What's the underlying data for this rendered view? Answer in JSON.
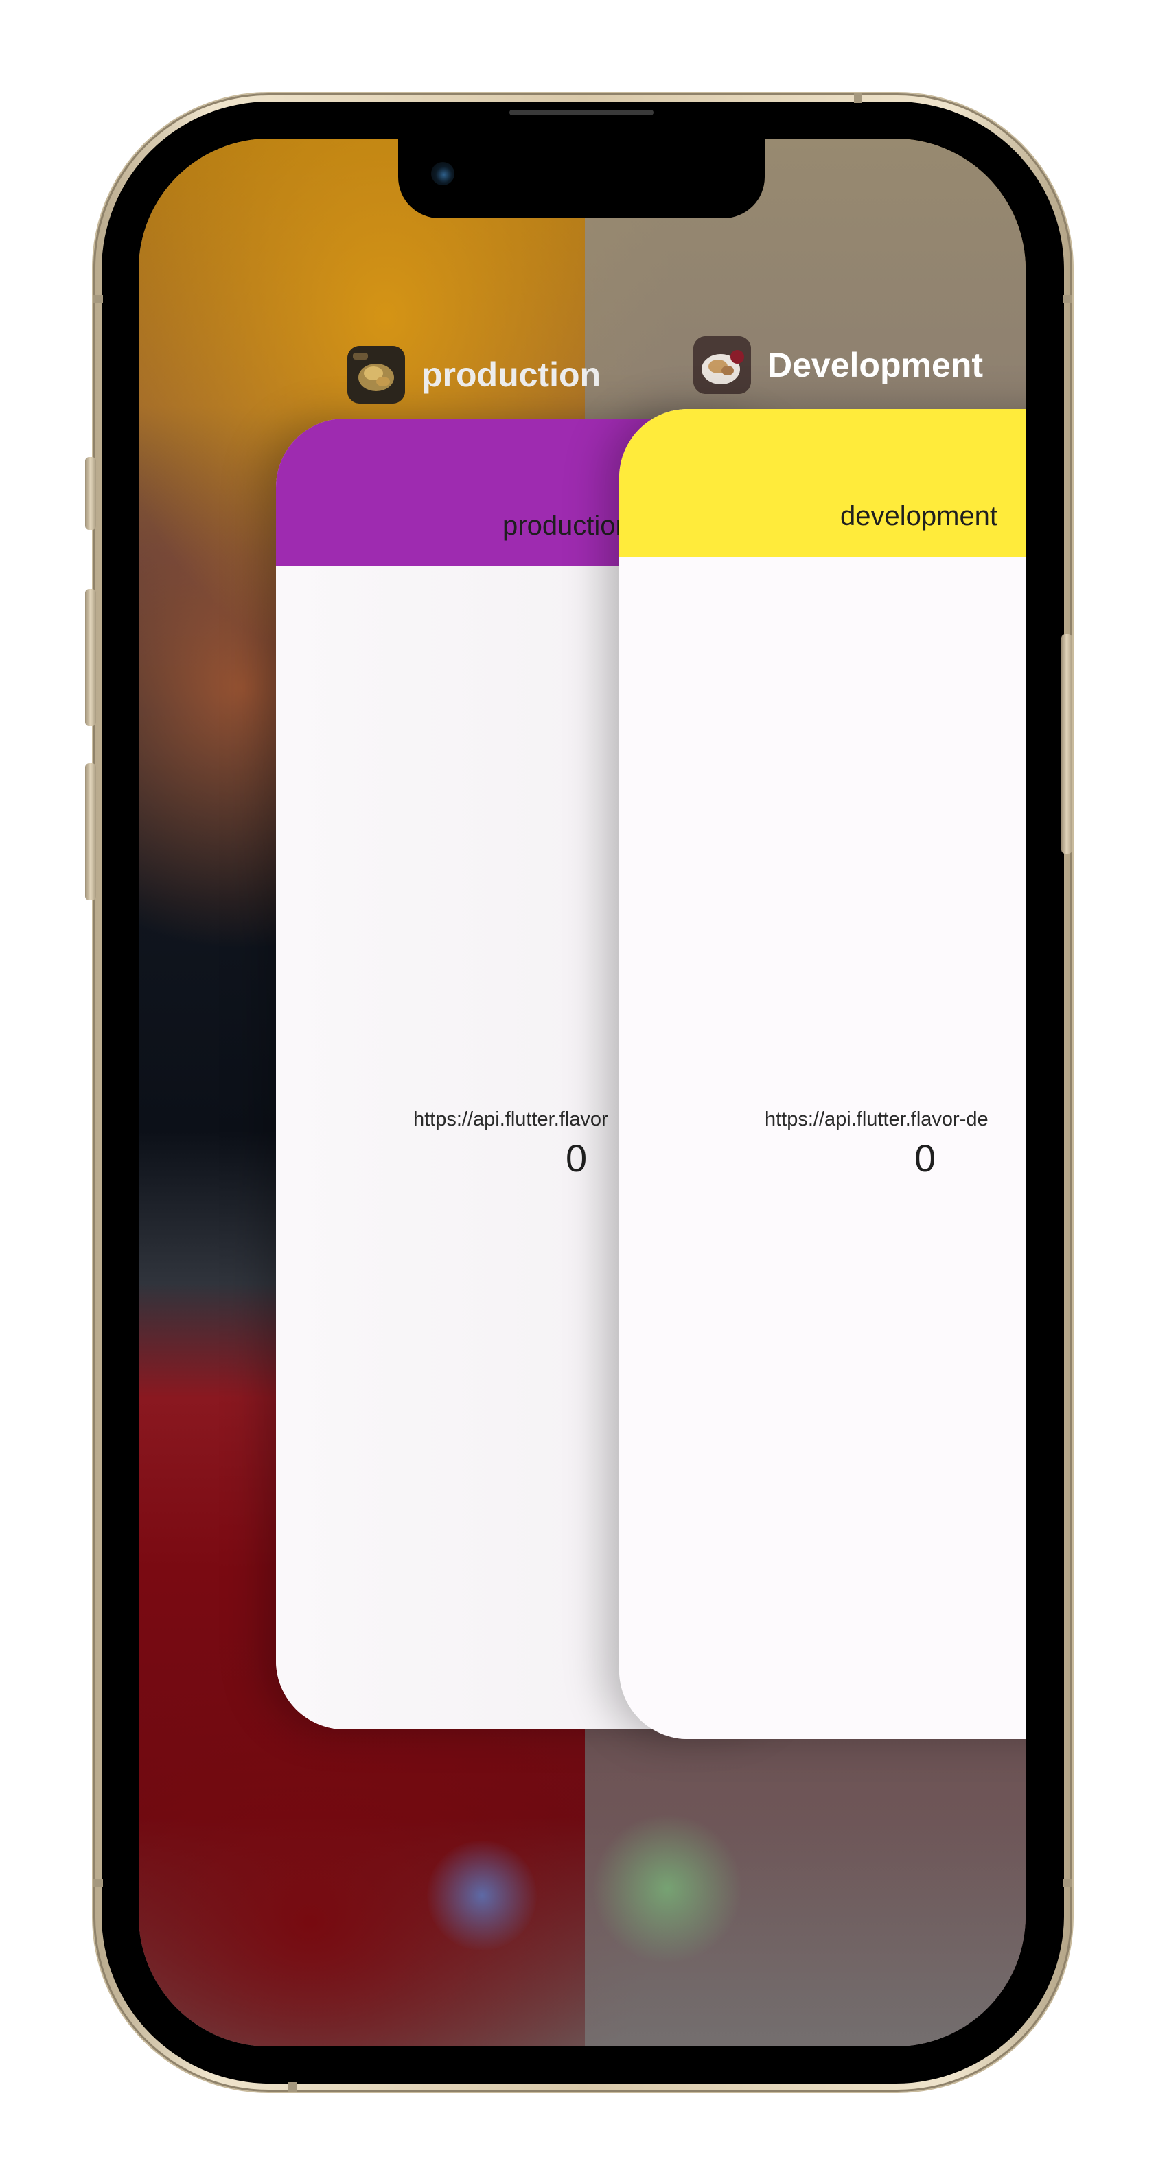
{
  "app_switcher": {
    "apps": [
      {
        "id": "production",
        "label": "production",
        "app_bar_title": "production",
        "app_bar_color": "#9e2bb0",
        "api_url": "https://api.flutter.flavor",
        "counter": "0",
        "icon": "food-photo-icon"
      },
      {
        "id": "development",
        "label": "Development",
        "app_bar_title": "development",
        "app_bar_color": "#ffeb3b",
        "api_url": "https://api.flutter.flavor-de",
        "counter": "0",
        "icon": "food-photo-icon"
      }
    ]
  },
  "device": {
    "frame_color": "#d9c9aa"
  }
}
